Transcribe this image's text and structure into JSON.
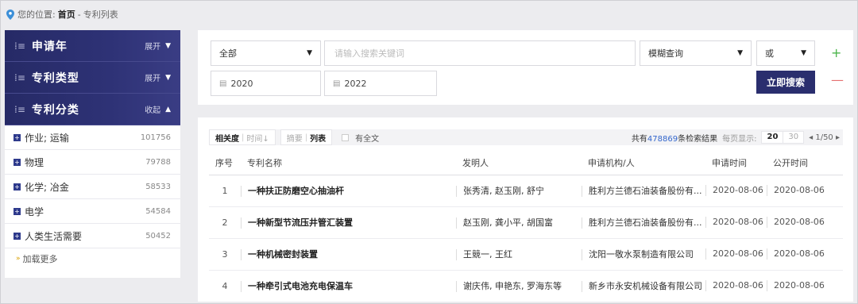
{
  "breadcrumb": {
    "prefix": "您的位置:",
    "home": "首页",
    "separator": "-",
    "current": "专利列表"
  },
  "sidebar": {
    "sections": [
      {
        "title": "申请年",
        "toggle": "展开",
        "arrow": "▼"
      },
      {
        "title": "专利类型",
        "toggle": "展开",
        "arrow": "▼"
      },
      {
        "title": "专利分类",
        "toggle": "收起",
        "arrow": "▲"
      }
    ],
    "items": [
      {
        "label": "作业; 运输",
        "count": "101756"
      },
      {
        "label": "物理",
        "count": "79788"
      },
      {
        "label": "化学; 冶金",
        "count": "58533"
      },
      {
        "label": "电学",
        "count": "54584"
      },
      {
        "label": "人类生活需要",
        "count": "50452"
      }
    ],
    "load_more": "加载更多"
  },
  "search": {
    "field_select": "全部",
    "keyword_placeholder": "请输入搜索关键词",
    "mode_select": "模糊查询",
    "logic_select": "或",
    "year_from": "2020",
    "year_to": "2022",
    "submit_label": "立即搜索",
    "add_label": "+",
    "remove_label": "—"
  },
  "toolbar": {
    "sort_relevance": "相关度",
    "sort_time": "时间↓",
    "view_abstract": "摘要",
    "view_list": "列表",
    "fulltext_label": "有全文",
    "total_prefix": "共有",
    "total_count": "478869",
    "total_suffix": "条检索结果",
    "per_page_label": "每页显示:",
    "per_page_20": "20",
    "per_page_30": "30",
    "page_indicator": "◂ 1/50 ▸"
  },
  "table": {
    "headers": [
      "序号",
      "专利名称",
      "发明人",
      "申请机构/人",
      "申请时间",
      "公开时间"
    ],
    "rows": [
      {
        "no": "1",
        "name": "一种扶正防磨空心抽油杆",
        "inventors": "张秀清, 赵玉刚, 舒宁",
        "org": "胜利方兰德石油装备股份有...",
        "apply_date": "2020-08-06",
        "publish_date": "2020-08-06"
      },
      {
        "no": "2",
        "name": "一种新型节流压井管汇装置",
        "inventors": "赵玉刚, 龚小平, 胡国富",
        "org": "胜利方兰德石油装备股份有...",
        "apply_date": "2020-08-06",
        "publish_date": "2020-08-06"
      },
      {
        "no": "3",
        "name": "一种机械密封装置",
        "inventors": "王競一, 王红",
        "org": "沈阳一敬水泵制造有限公司",
        "apply_date": "2020-08-06",
        "publish_date": "2020-08-06"
      },
      {
        "no": "4",
        "name": "一种牵引式电池充电保温车",
        "inventors": "谢庆伟, 申艳东, 罗海东等",
        "org": "新乡市永安机械设备有限公司",
        "apply_date": "2020-08-06",
        "publish_date": "2020-08-06"
      }
    ]
  },
  "colors": {
    "accent_navy": "#2a2e6e",
    "link_blue": "#3366cc",
    "plus_green": "#4cb54c",
    "minus_red": "#e57171"
  },
  "icons": {
    "location": "location-pin-icon",
    "filter": "filter-lines-icon",
    "calendar": "calendar-icon",
    "expand": "plus-square-icon"
  }
}
